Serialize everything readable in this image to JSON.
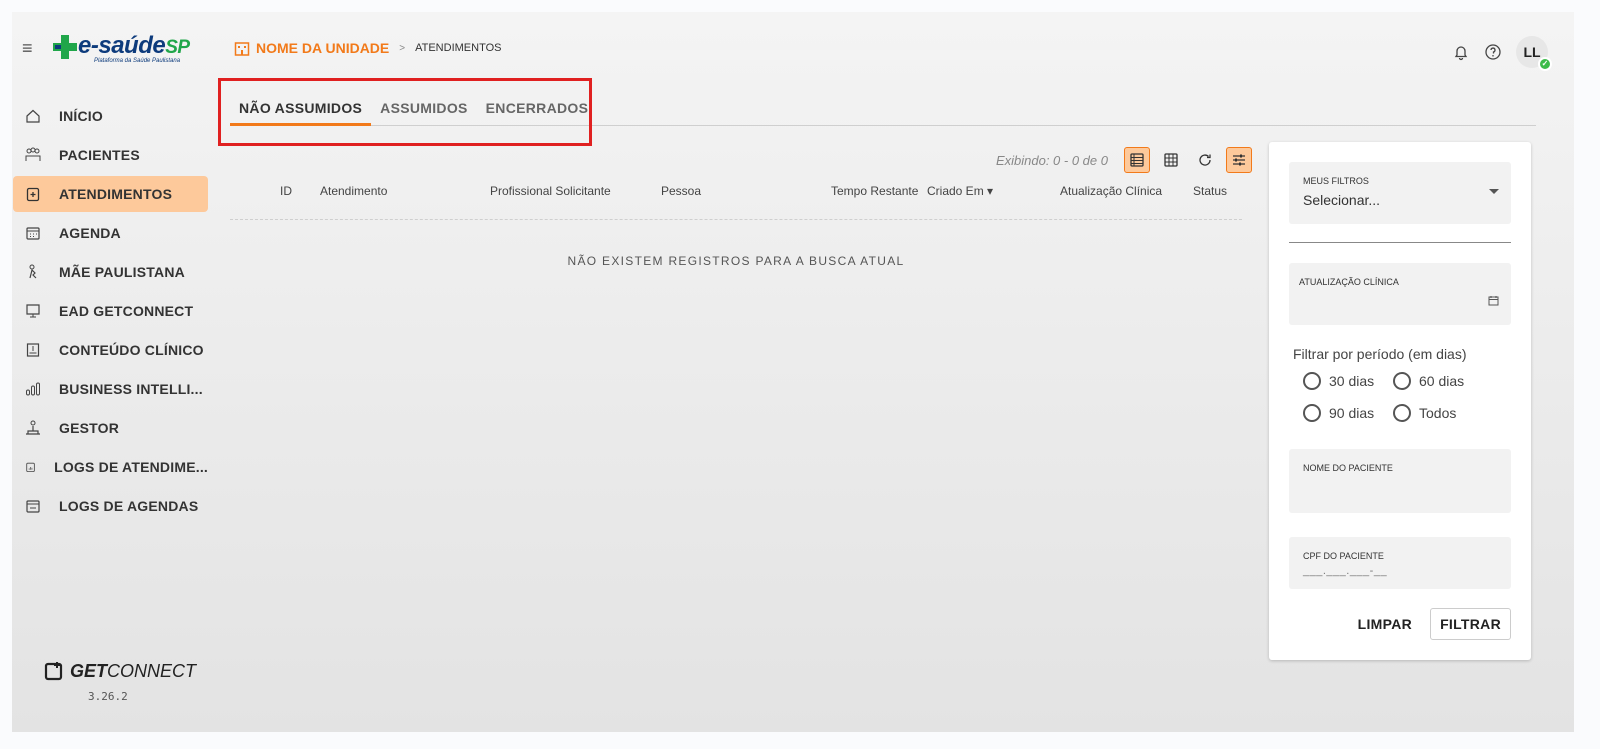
{
  "header": {
    "logo": {
      "brand": "e-saúde",
      "brand_suffix": "SP",
      "tagline": "Plataforma da Saúde Paulistana"
    },
    "breadcrumb": {
      "unit": "NOME DA UNIDADE",
      "separator": ">",
      "page": "ATENDIMENTOS"
    },
    "icons": [
      "bell-icon",
      "help-icon"
    ],
    "avatar": {
      "initials": "LL",
      "status": "online"
    }
  },
  "sidebar": {
    "items": [
      {
        "label": "INÍCIO",
        "icon": "home-icon",
        "active": false
      },
      {
        "label": "PACIENTES",
        "icon": "patients-icon",
        "active": false
      },
      {
        "label": "ATENDIMENTOS",
        "icon": "clipboard-icon",
        "active": true
      },
      {
        "label": "AGENDA",
        "icon": "calendar-icon",
        "active": false
      },
      {
        "label": "MÃE PAULISTANA",
        "icon": "mother-icon",
        "active": false
      },
      {
        "label": "EAD GETCONNECT",
        "icon": "ead-icon",
        "active": false
      },
      {
        "label": "CONTEÚDO CLÍNICO",
        "icon": "book-icon",
        "active": false
      },
      {
        "label": "BUSINESS INTELLI...",
        "icon": "chart-icon",
        "active": false
      },
      {
        "label": "GESTOR",
        "icon": "manager-icon",
        "active": false
      },
      {
        "label": "LOGS DE ATENDIME...",
        "icon": "log-chart-icon",
        "active": false
      },
      {
        "label": "LOGS DE AGENDAS",
        "icon": "log-calendar-icon",
        "active": false
      }
    ],
    "footer": {
      "brand_bold": "GET",
      "brand_light": "CONNECT",
      "version": "3.26.2"
    }
  },
  "tabs": [
    {
      "label": "NÃO ASSUMIDOS",
      "active": true
    },
    {
      "label": "ASSUMIDOS",
      "active": false
    },
    {
      "label": "ENCERRADOS",
      "active": false
    }
  ],
  "toolbar": {
    "showing": "Exibindo: 0 - 0 de 0"
  },
  "table": {
    "columns": [
      "ID",
      "Atendimento",
      "Profissional Solicitante",
      "Pessoa",
      "Tempo Restante",
      "Criado Em ▾",
      "Atualização Clínica",
      "Status"
    ],
    "empty_message": "NÃO EXISTEM REGISTROS PARA A BUSCA ATUAL"
  },
  "filters": {
    "my_filters": {
      "label": "MEUS FILTROS",
      "value": "Selecionar..."
    },
    "clinical_update": {
      "label": "ATUALIZAÇÃO CLÍNICA"
    },
    "period": {
      "title": "Filtrar por período (em dias)",
      "options": [
        "30 dias",
        "60 dias",
        "90 dias",
        "Todos"
      ]
    },
    "patient_name": {
      "label": "NOME DO PACIENTE"
    },
    "patient_cpf": {
      "label": "CPF DO PACIENTE",
      "placeholder": "___.___.___-__"
    },
    "clear_label": "LIMPAR",
    "filter_label": "FILTRAR"
  },
  "colors": {
    "accent": "#f27a1a",
    "active_bg": "#fdc99b",
    "highlight": "#e02020"
  }
}
